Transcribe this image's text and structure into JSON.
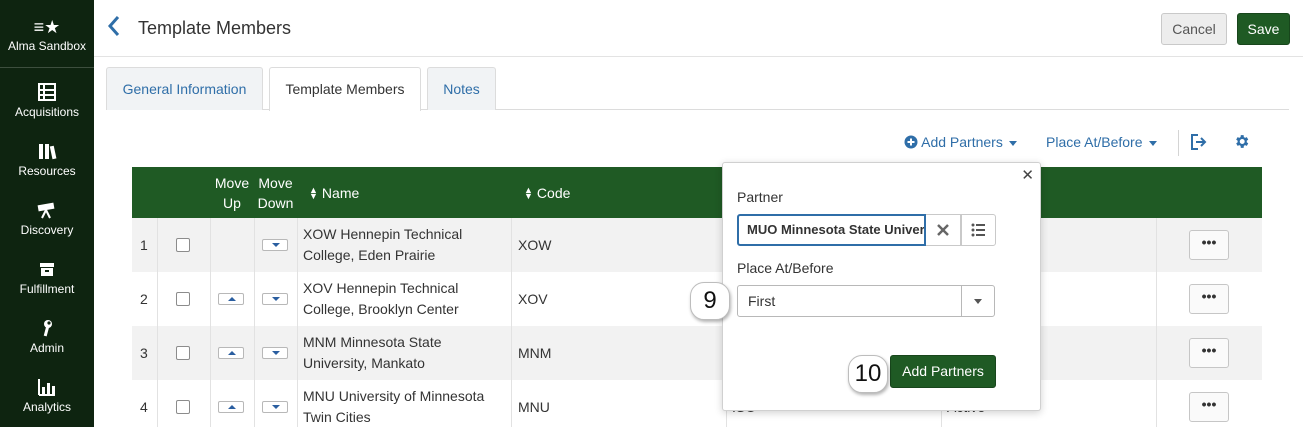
{
  "sidebar": {
    "items": [
      {
        "label": "Alma Sandbox",
        "icon": "sandbox-icon",
        "glyph": "≡★"
      },
      {
        "label": "Acquisitions",
        "icon": "acquisitions-icon",
        "glyph": "▦"
      },
      {
        "label": "Resources",
        "icon": "resources-icon",
        "glyph": "❙❙❙"
      },
      {
        "label": "Discovery",
        "icon": "discovery-icon",
        "glyph": "⌖"
      },
      {
        "label": "Fulfillment",
        "icon": "fulfillment-icon",
        "glyph": "▤"
      },
      {
        "label": "Admin",
        "icon": "wrench-icon",
        "glyph": "⚲"
      },
      {
        "label": "Analytics",
        "icon": "analytics-icon",
        "glyph": "▁▃▅"
      }
    ]
  },
  "header": {
    "back_glyph": "‹",
    "title": "Template Members",
    "cancel_label": "Cancel",
    "save_label": "Save"
  },
  "tabs": [
    {
      "label": "General Information",
      "active": false
    },
    {
      "label": "Template Members",
      "active": true
    },
    {
      "label": "Notes",
      "active": false
    }
  ],
  "toolbar": {
    "add_partners_label": "Add Partners",
    "place_at_before_label": "Place At/Before"
  },
  "table": {
    "headers": {
      "move_up": "Move Up",
      "move_down": "Move Down",
      "name": "Name",
      "code": "Code"
    },
    "rows": [
      {
        "index": "1",
        "name": "XOW Hennepin Technical College, Eden Prairie",
        "code": "XOW",
        "col5": "",
        "col6": "",
        "show_up": false
      },
      {
        "index": "2",
        "name": "XOV Hennepin Technical College, Brooklyn Center",
        "code": "XOV",
        "col5": "",
        "col6": "",
        "show_up": true
      },
      {
        "index": "3",
        "name": "MNM Minnesota State University, Mankato",
        "code": "MNM",
        "col5": "",
        "col6": "",
        "show_up": true
      },
      {
        "index": "4",
        "name": "MNU University of Minnesota Twin Cities",
        "code": "MNU",
        "col5": "ISO",
        "col6": "Active",
        "show_up": true
      }
    ],
    "actions_label": "•••"
  },
  "popup": {
    "close_glyph": "✕",
    "partner_label": "Partner",
    "partner_value": "MUO Minnesota State University Moorhead",
    "place_label": "Place At/Before",
    "place_value": "First",
    "submit_label": "Add Partners"
  },
  "badges": {
    "step9": "9",
    "step10": "10"
  },
  "colors": {
    "sidebar_bg": "#0e2410",
    "primary_green": "#1f5a24",
    "link_blue": "#2f6ea8"
  }
}
